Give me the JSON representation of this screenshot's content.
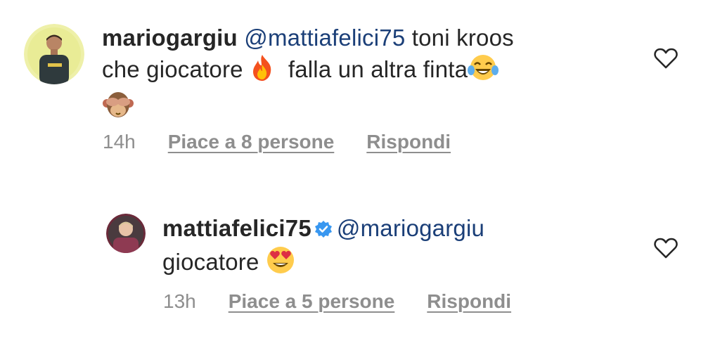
{
  "comments": [
    {
      "username": "mariogargiu",
      "mention": "@mattiafelici75",
      "text_line1": "toni kroos",
      "text_line2a": "che giocatore",
      "text_line2b": "falla un altra finta",
      "time": "14h",
      "likes": "Piace a 8 persone",
      "reply": "Rispondi",
      "emojis": [
        "fire-emoji",
        "laughing-tears-emoji",
        "see-no-evil-monkey-emoji"
      ]
    },
    {
      "username": "mattiafelici75",
      "verified": true,
      "mention": "@mariogargiu",
      "text_line2": "giocatore",
      "time": "13h",
      "likes": "Piace a 5 persone",
      "reply": "Rispondi",
      "emojis": [
        "heart-eyes-emoji"
      ]
    }
  ],
  "colors": {
    "text": "#262626",
    "mention": "#1b3f78",
    "meta": "#8e8e8e",
    "verified": "#3897f0"
  }
}
